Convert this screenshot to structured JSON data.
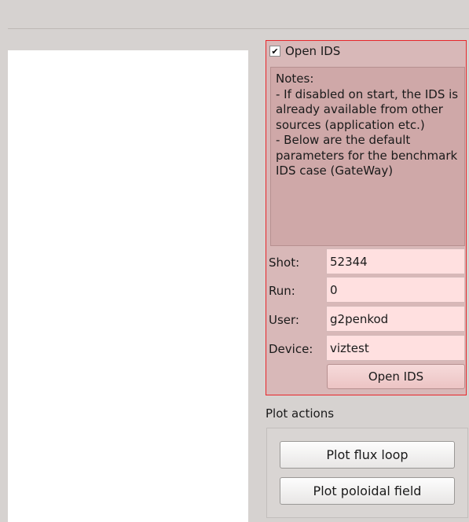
{
  "ids_panel": {
    "checkbox_label": "Open IDS",
    "checked": true,
    "check_mark": "✔",
    "notes": "Notes:\n - If disabled on start, the IDS is already available from other sources (application etc.)\n - Below are the default parameters for the benchmark IDS case (GateWay)",
    "fields": [
      {
        "label": "Shot:",
        "value": "52344"
      },
      {
        "label": "Run:",
        "value": "0"
      },
      {
        "label": "User:",
        "value": "g2penkod"
      },
      {
        "label": "Device:",
        "value": "viztest"
      }
    ],
    "open_button_label": "Open IDS",
    "border_color": "#e8262a",
    "background_color": "#d8b8b8",
    "input_background": "#ffe0e0"
  },
  "plot_actions": {
    "title": "Plot actions",
    "buttons": [
      {
        "label": "Plot flux loop"
      },
      {
        "label": "Plot poloidal field"
      }
    ]
  }
}
